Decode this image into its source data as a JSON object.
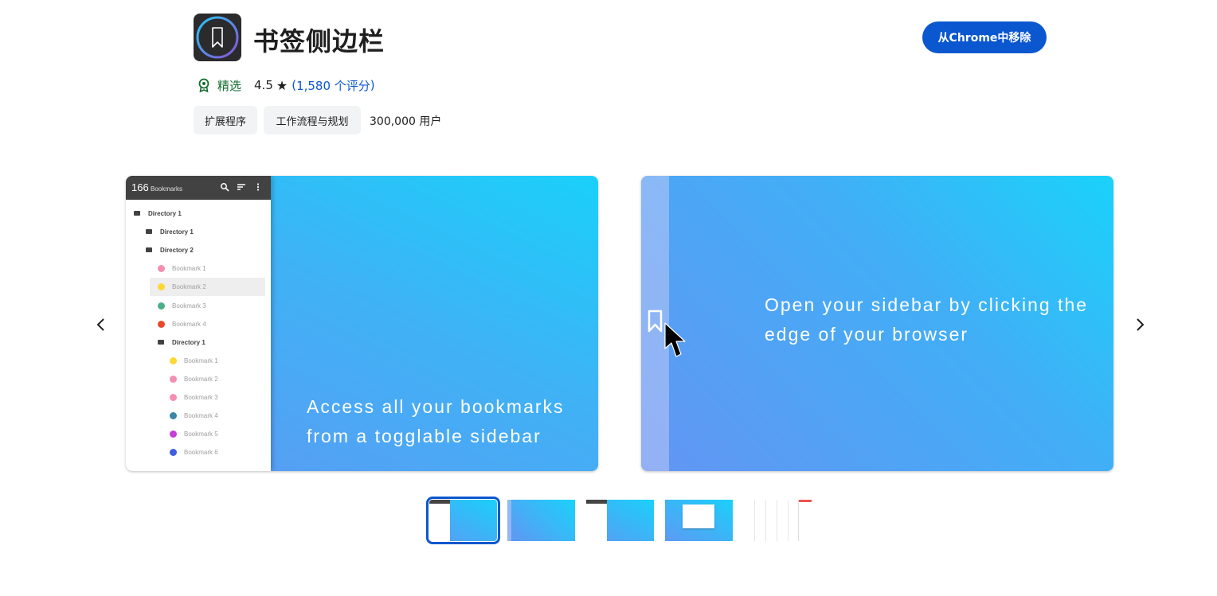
{
  "extension": {
    "title": "书签侧边栏",
    "icon": "bookmark-icon",
    "remove_button_label": "从Chrome中移除",
    "featured_label": "精选",
    "featured_icon": "award-badge-icon",
    "rating": "4.5",
    "rating_star": "★",
    "rating_count": "1,580 个评分",
    "rating_open": "(",
    "rating_close": ")",
    "tags": [
      "扩展程序",
      "工作流程与规划"
    ],
    "users": "300,000 用户"
  },
  "colors": {
    "accent": "#0b57d0",
    "featured_green": "#146c2e",
    "slide_gradient_start": "#1ad0fa",
    "slide_gradient_end": "#5d9af4"
  },
  "carousel": {
    "prev_icon": "chevron-left-icon",
    "next_icon": "chevron-right-icon",
    "slides": [
      {
        "sidebar": {
          "count": "166",
          "count_label": "Bookmarks",
          "header_icons": [
            "search-icon",
            "sort-icon",
            "more-vert-icon"
          ],
          "tree": [
            {
              "label": "Directory 1",
              "type": "folder"
            },
            {
              "label": "Directory 1",
              "type": "folder"
            },
            {
              "label": "Directory 2",
              "type": "folder"
            },
            {
              "label": "Bookmark 1",
              "type": "bookmark",
              "color": "#f48fb1"
            },
            {
              "label": "Bookmark 2",
              "type": "bookmark",
              "color": "#fdd835",
              "selected": true
            },
            {
              "label": "Bookmark 3",
              "type": "bookmark",
              "color": "#4caf8a"
            },
            {
              "label": "Bookmark 4",
              "type": "bookmark",
              "color": "#e64a2e"
            },
            {
              "label": "Directory 1",
              "type": "folder"
            },
            {
              "label": "Bookmark 1",
              "type": "bookmark",
              "color": "#fdd835"
            },
            {
              "label": "Bookmark 2",
              "type": "bookmark",
              "color": "#f48fb1"
            },
            {
              "label": "Bookmark 3",
              "type": "bookmark",
              "color": "#f48fb1"
            },
            {
              "label": "Bookmark 4",
              "type": "bookmark",
              "color": "#3a86a8"
            },
            {
              "label": "Bookmark 5",
              "type": "bookmark",
              "color": "#c53fd6"
            },
            {
              "label": "Bookmark 6",
              "type": "bookmark",
              "color": "#3f5fe0"
            }
          ]
        },
        "caption_line1": "Access all your bookmarks",
        "caption_line2": "from a togglable sidebar"
      },
      {
        "caption_line1": "Open your sidebar by clicking the",
        "caption_line2": "edge of your browser",
        "icons": [
          "bookmark-outline-icon",
          "mouse-cursor-icon"
        ]
      }
    ],
    "thumbnails": [
      {
        "active": true
      },
      {
        "active": false
      },
      {
        "active": false
      },
      {
        "active": false
      },
      {
        "active": false
      }
    ]
  }
}
